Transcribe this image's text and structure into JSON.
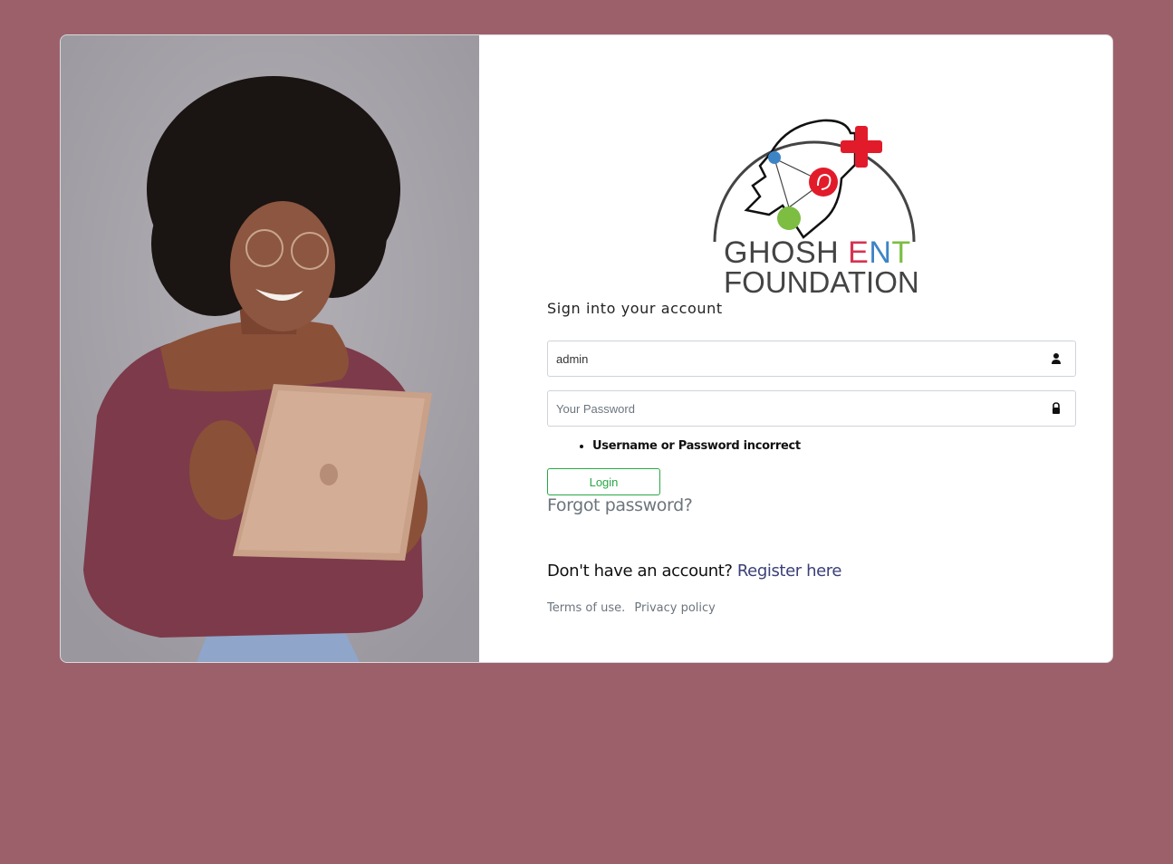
{
  "brand": {
    "line1_part1": "GHOSH ",
    "line1_e": "E",
    "line1_n": "N",
    "line1_t": "T",
    "line2": "FOUNDATION",
    "colors": {
      "text": "#444444",
      "e": "#d63351",
      "n": "#3d84c6",
      "t": "#7cbd42",
      "cross": "#e21b2b",
      "blue_dot": "#3d84c6",
      "green_dot": "#7cbd42",
      "red_dot": "#e21b2b"
    }
  },
  "form": {
    "title": "Sign into your account",
    "username_value": "admin",
    "password_placeholder": "Your Password",
    "username_icon": "user-icon",
    "password_icon": "lock-icon",
    "errors": [
      "Username or Password incorrect"
    ],
    "login_label": "Login",
    "forgot_label": "Forgot password?"
  },
  "register": {
    "prompt": "Don't have an account? ",
    "link_label": "Register here"
  },
  "footer": {
    "terms": "Terms of use.",
    "privacy": "Privacy policy"
  },
  "colors": {
    "page_background": "#9c606b",
    "card_background": "#ffffff",
    "login_accent": "#28a745",
    "link": "#3b3f78"
  }
}
